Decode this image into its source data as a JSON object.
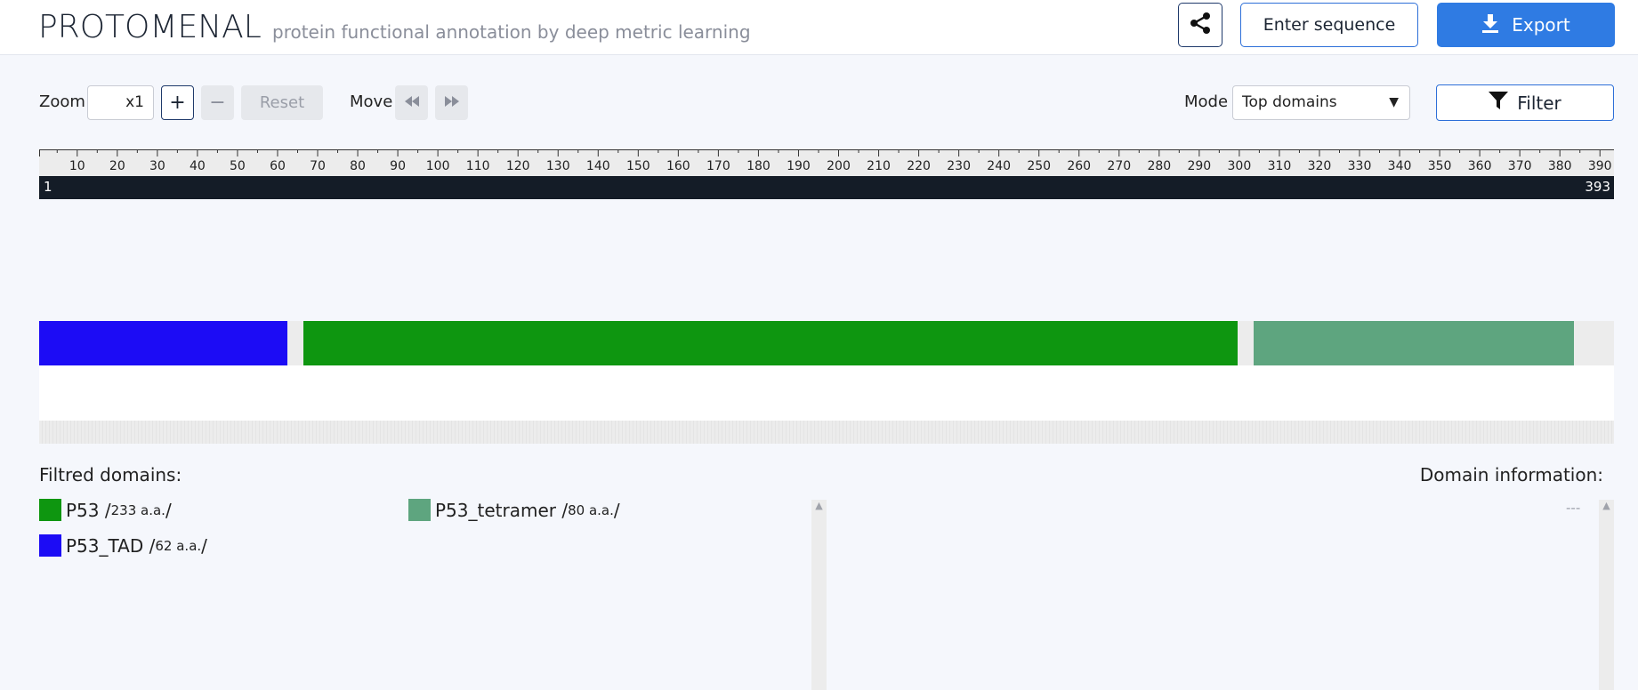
{
  "header": {
    "logo": "PROTOMENAL",
    "tagline": "protein functional annotation by deep metric learning",
    "share_icon": "share-icon",
    "enter_sequence_label": "Enter sequence",
    "export_label": "Export",
    "export_icon": "download-icon"
  },
  "controls": {
    "zoom_label": "Zoom",
    "zoom_value": "x1",
    "zoom_in_label": "+",
    "zoom_out_label": "−",
    "reset_label": "Reset",
    "move_label": "Move",
    "move_left_icon": "rewind-icon",
    "move_right_icon": "fast-forward-icon",
    "mode_label": "Mode",
    "mode_value": "Top domains",
    "filter_label": "Filter",
    "filter_icon": "filter-icon"
  },
  "ruler": {
    "ticks": [
      "10",
      "20",
      "30",
      "40",
      "50",
      "60",
      "70",
      "80",
      "90",
      "100",
      "110",
      "120",
      "130",
      "140",
      "150",
      "160",
      "170",
      "180",
      "190",
      "200",
      "210",
      "220",
      "230",
      "240",
      "250",
      "260",
      "270",
      "280",
      "290",
      "300",
      "310",
      "320",
      "330",
      "340",
      "350",
      "360",
      "370",
      "380",
      "390"
    ],
    "start": "1",
    "end": "393",
    "length": 393
  },
  "domains_track": [
    {
      "name": "P53_TAD",
      "start": 1,
      "end": 62,
      "color": "#1c0cf5"
    },
    {
      "name": "P53",
      "start": 67,
      "end": 299,
      "color": "#0e9610"
    },
    {
      "name": "P53_tetramer",
      "start": 304,
      "end": 383,
      "color": "#5ea57f"
    }
  ],
  "filtered": {
    "title": "Filtred domains:",
    "items": [
      {
        "name": "P53",
        "length": "233 a.a.",
        "color": "#0e9610"
      },
      {
        "name": "P53_tetramer",
        "length": "80 a.a.",
        "color": "#5ea57f"
      },
      {
        "name": "P53_TAD",
        "length": "62 a.a.",
        "color": "#1c0cf5"
      }
    ]
  },
  "info": {
    "title": "Domain information:",
    "empty": "---"
  }
}
